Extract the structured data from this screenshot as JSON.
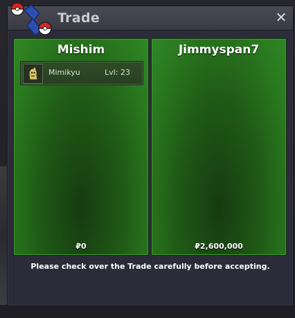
{
  "window": {
    "title": "Trade",
    "close_icon": "close-icon",
    "logo_icon": "pokeball-logo-icon"
  },
  "left_panel": {
    "name": "Mishim",
    "items": [
      {
        "icon": "mimikyu-sprite-icon",
        "name": "Mimikyu",
        "level": "Lvl: 23"
      }
    ],
    "money": "₽0"
  },
  "right_panel": {
    "name": "Jimmyspan7",
    "items": [],
    "money": "₽2,600,000"
  },
  "notice": "Please check over the Trade carefully before accepting.",
  "colors": {
    "panel_green": "#2a7a1f",
    "panel_dark_green": "#163b10",
    "window_bg": "#2b2b3a",
    "titlebar": "#43434d",
    "text": "#ffffff"
  }
}
